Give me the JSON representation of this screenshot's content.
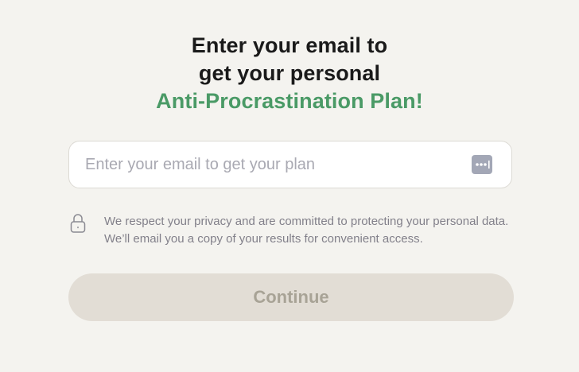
{
  "heading": {
    "line1": "Enter your email to",
    "line2": "get your personal",
    "accent": "Anti-Procrastination Plan!",
    "accent_color": "#4a9a66"
  },
  "email": {
    "placeholder": "Enter your email to get your plan",
    "value": "",
    "trailing_icon": "password-manager-icon"
  },
  "privacy": {
    "icon": "lock-icon",
    "text": "We respect your privacy and are committed to protecting your personal data. We’ll email you a copy of your results for convenient access."
  },
  "continue_button": {
    "label": "Continue",
    "state": "disabled",
    "background": "#e2ddd5",
    "text_color": "#a8a396"
  }
}
